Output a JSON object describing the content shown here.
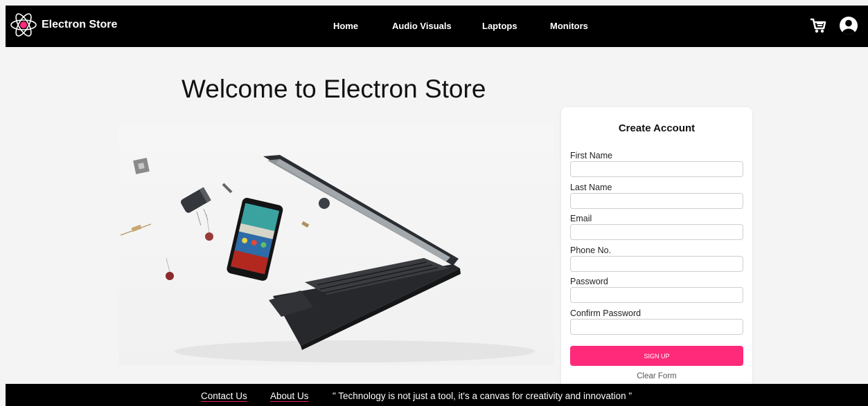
{
  "brand": {
    "name": "Electron Store",
    "logo_icon": "atom-icon"
  },
  "nav": {
    "home": "Home",
    "audio": "Audio Visuals",
    "laptops": "Laptops",
    "monitors": "Monitors"
  },
  "header_icons": {
    "cart": "cart-icon",
    "profile": "user-icon"
  },
  "hero": {
    "title": "Welcome to Electron Store"
  },
  "form": {
    "title": "Create Account",
    "first_name": "First Name",
    "last_name": "Last Name",
    "email": "Email",
    "phone": "Phone No.",
    "password": "Password",
    "confirm_password": "Confirm Password",
    "submit": "SIGN UP",
    "clear": "Clear Form"
  },
  "footer": {
    "contact": "Contact Us",
    "about": "About Us",
    "quote": "\" Technology is not just a tool, it's a canvas for creativity and innovation \""
  },
  "colors": {
    "accent": "#ff2a7a",
    "bar": "#000000",
    "background": "#f4f4f4"
  }
}
